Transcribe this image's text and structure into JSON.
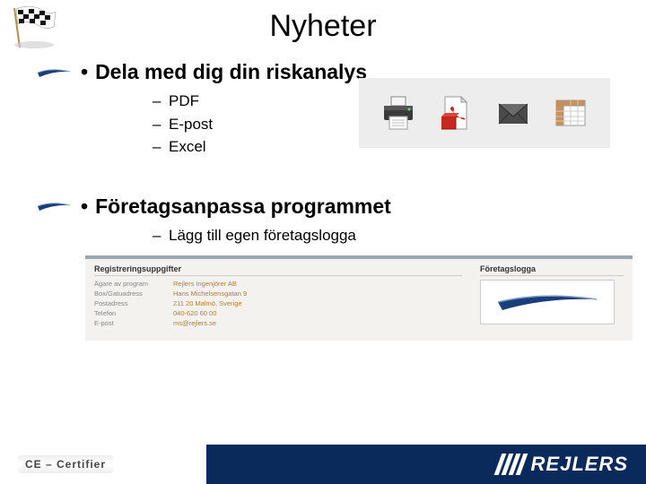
{
  "title": "Nyheter",
  "bullets": [
    {
      "text": "Dela med dig din riskanalys",
      "subs": [
        "PDF",
        "E-post",
        "Excel"
      ]
    },
    {
      "text": "Företagsanpassa programmet",
      "subs": [
        "Lägg till egen företagslogga"
      ]
    }
  ],
  "form": {
    "heading_left": "Registreringsuppgifter",
    "heading_right": "Företagslogga",
    "rows": [
      {
        "label": "Ägare av program",
        "value": "Rejlers Ingenjörer AB"
      },
      {
        "label": "Box/Gatuadress",
        "value": "Hans Michelsensgatan 9"
      },
      {
        "label": "Postadress",
        "value": "211 20 Malmö, Sverige"
      },
      {
        "label": "Telefon",
        "value": "040-620 60 00"
      },
      {
        "label": "E-post",
        "value": "ms@rejlers.se"
      }
    ]
  },
  "footer": {
    "left": "CE – Certifier",
    "right": "REJLERS"
  },
  "icons": {
    "print": "print-icon",
    "pdf": "pdf-icon",
    "mail": "mail-icon",
    "excel": "excel-icon"
  }
}
